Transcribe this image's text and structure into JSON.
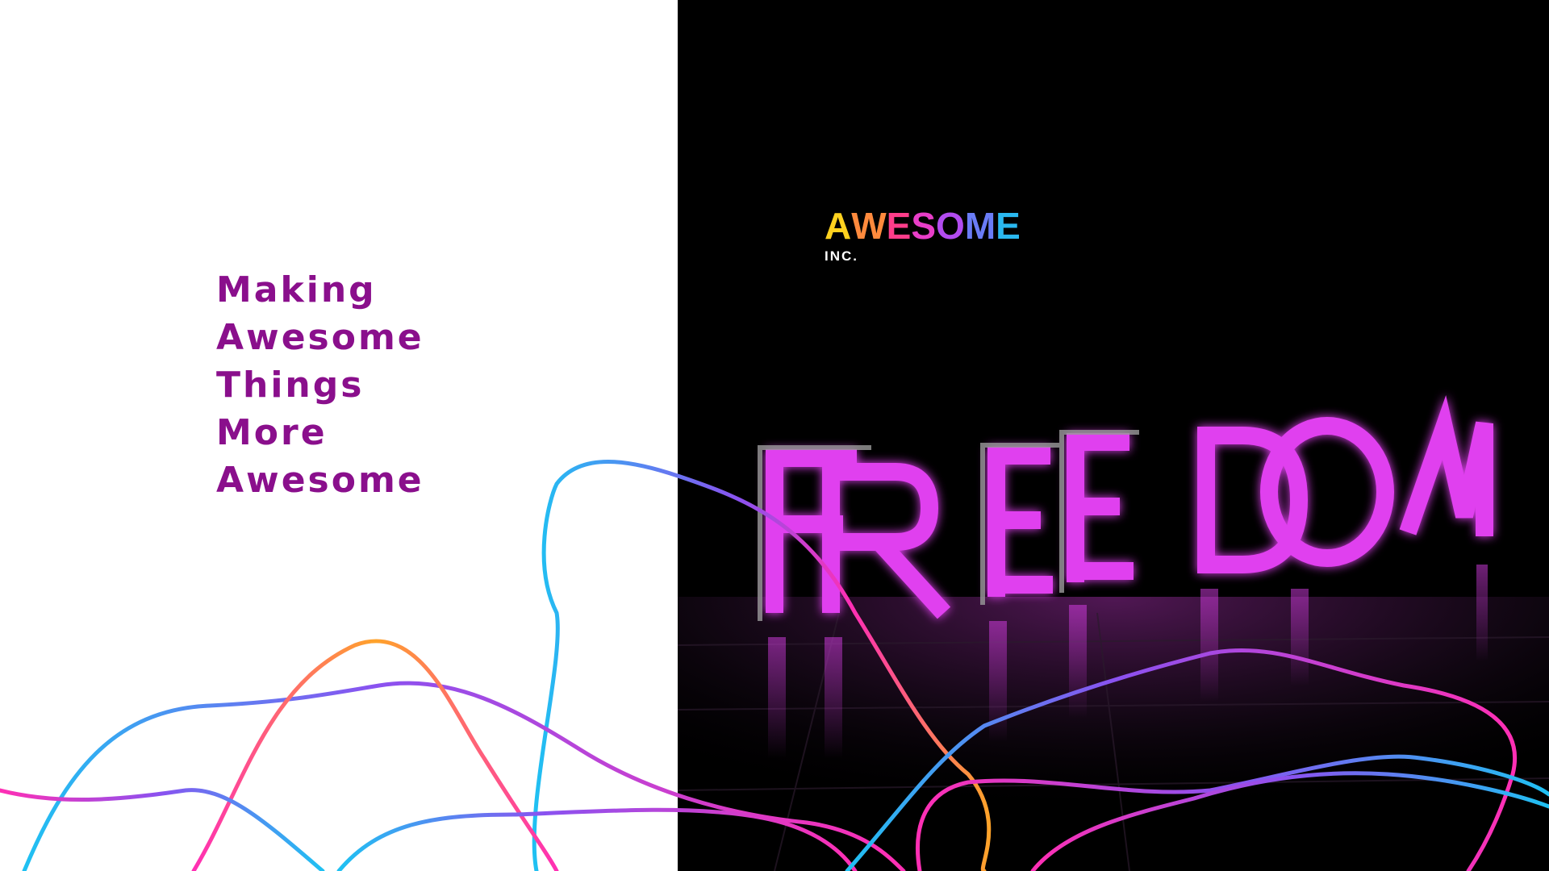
{
  "tagline": {
    "lines": [
      "Making",
      "Awesome",
      "Things",
      "More",
      "Awesome"
    ]
  },
  "logo": {
    "word": "AWESOME",
    "letters": [
      "A",
      "W",
      "E",
      "S",
      "O",
      "M",
      "E"
    ],
    "letter_colors": [
      "#ffd21f",
      "#ff8a3d",
      "#ff3d8a",
      "#e83ec8",
      "#b24cf0",
      "#6a7cf6",
      "#2ab8f0"
    ],
    "sub": "INC."
  },
  "photo": {
    "sign_letters": [
      "F",
      "R",
      "E",
      "E",
      "D",
      "O",
      "M"
    ],
    "neon_color": "#e040ef"
  },
  "colors": {
    "tagline": "#8a0f8c",
    "line_cyan": "#1fc1f2",
    "line_magenta": "#ff2fb4",
    "line_orange": "#ffa32a",
    "line_violet": "#8a52f0"
  }
}
